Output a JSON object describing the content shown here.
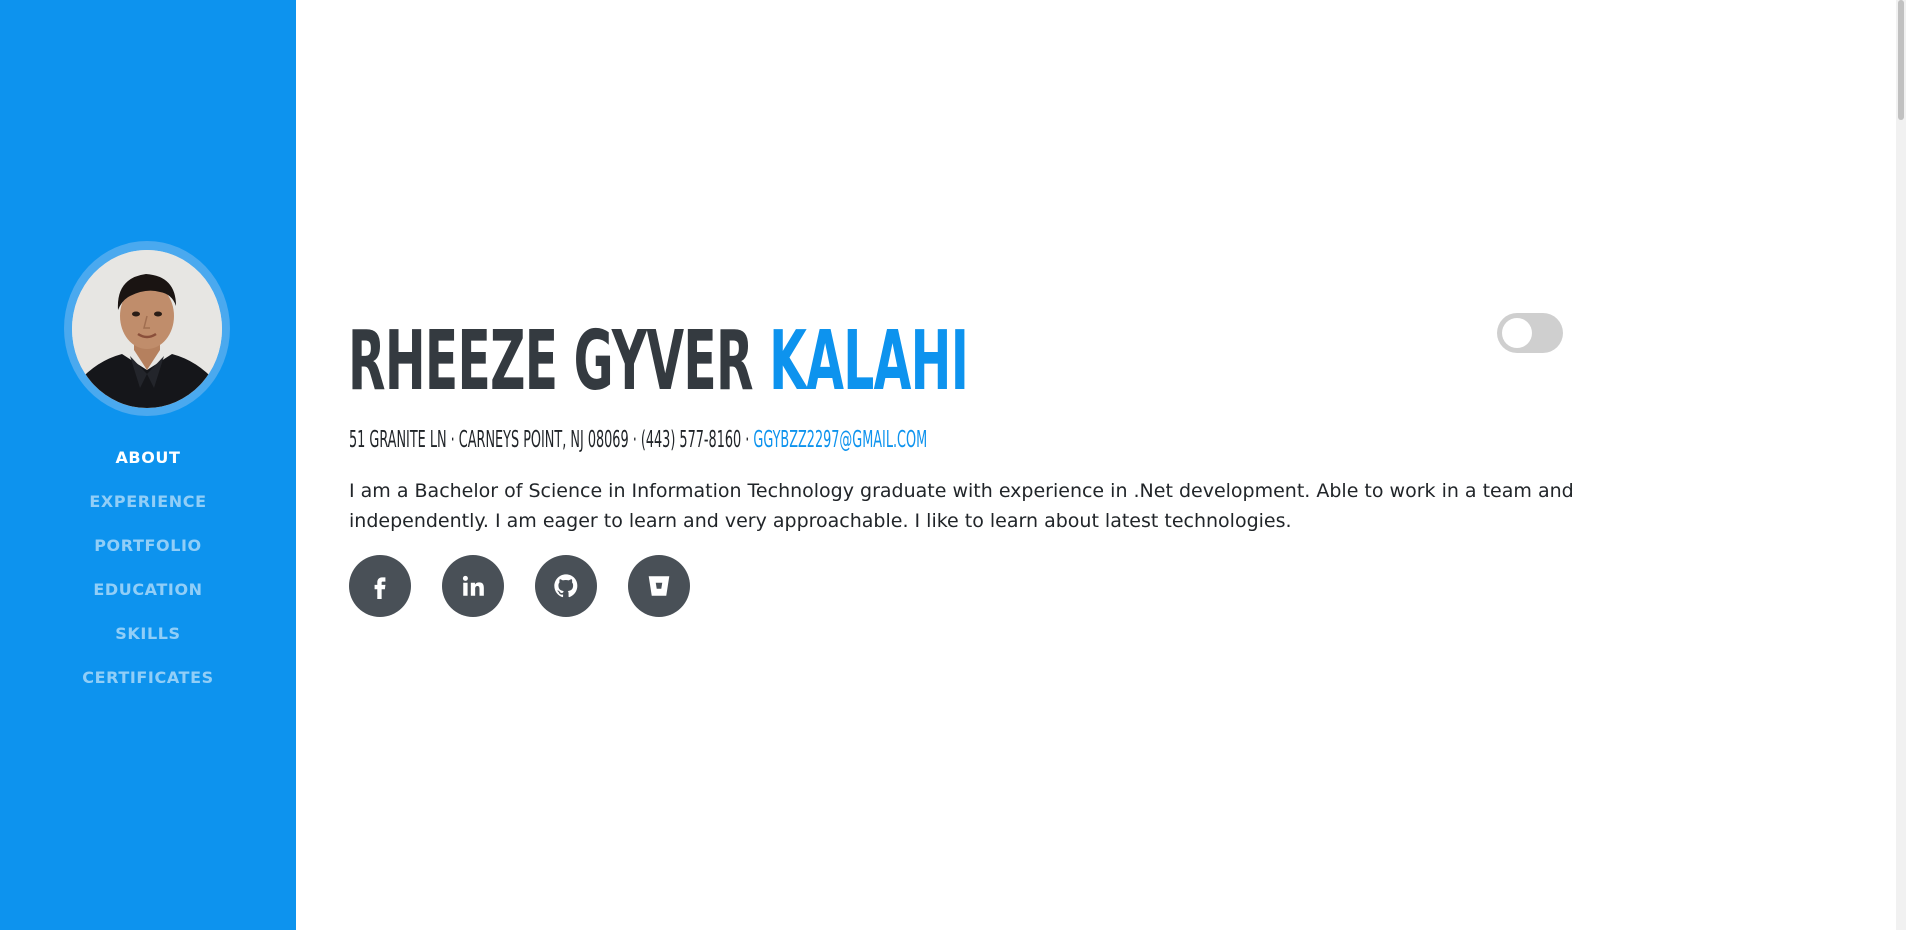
{
  "colors": {
    "primary": "#0d93ee",
    "heading": "#343a40",
    "text": "#212529",
    "social_bg": "#495057"
  },
  "sidebar": {
    "avatar_alt": "profile-photo",
    "nav": [
      {
        "label": "ABOUT",
        "active": true
      },
      {
        "label": "EXPERIENCE",
        "active": false
      },
      {
        "label": "PORTFOLIO",
        "active": false
      },
      {
        "label": "EDUCATION",
        "active": false
      },
      {
        "label": "SKILLS",
        "active": false
      },
      {
        "label": "CERTIFICATES",
        "active": false
      }
    ]
  },
  "about": {
    "first_name": "RHEEZE GYVER",
    "last_name": "KALAHI",
    "address": "51 GRANITE LN · CARNEYS POINT, NJ 08069 · (443) 577-8160 ·",
    "email": "GGYBZZ2297@GMAIL.COM",
    "summary": "I am a Bachelor of Science in Information Technology graduate with experience in .Net development. Able to work in a team and independently. I am eager to learn and very approachable. I like to learn about latest technologies.",
    "theme_toggle_on": false
  },
  "social": [
    {
      "name": "facebook-icon"
    },
    {
      "name": "linkedin-icon"
    },
    {
      "name": "github-icon"
    },
    {
      "name": "bitbucket-icon"
    }
  ]
}
